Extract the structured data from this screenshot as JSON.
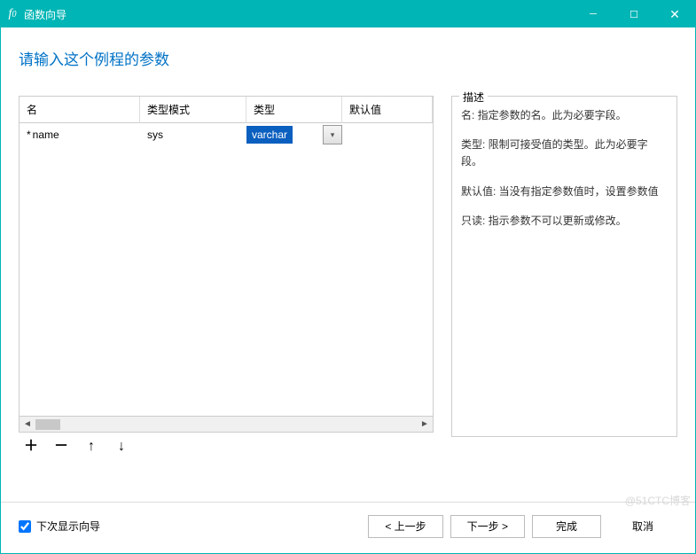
{
  "window": {
    "title": "函数向导"
  },
  "heading": "请输入这个例程的参数",
  "table": {
    "headers": {
      "name": "名",
      "mode": "类型模式",
      "type": "类型",
      "default": "默认值"
    },
    "rows": [
      {
        "required": "*",
        "name": "name",
        "mode": "sys",
        "type": "varchar",
        "default": ""
      }
    ]
  },
  "description": {
    "legend": "描述",
    "name": "名: 指定参数的名。此为必要字段。",
    "type": "类型: 限制可接受值的类型。此为必要字段。",
    "default": "默认值: 当没有指定参数值时，设置参数值",
    "readonly": "只读: 指示参数不可以更新或修改。"
  },
  "footer": {
    "checkbox_label": "下次显示向导",
    "checkbox_checked": true,
    "back": "< 上一步",
    "next": "下一步 >",
    "finish": "完成",
    "cancel": "取消"
  },
  "toolbar_icons": {
    "add": "＋",
    "remove": "－",
    "up": "↑",
    "down": "↓"
  },
  "watermark": "@51CTC博客"
}
